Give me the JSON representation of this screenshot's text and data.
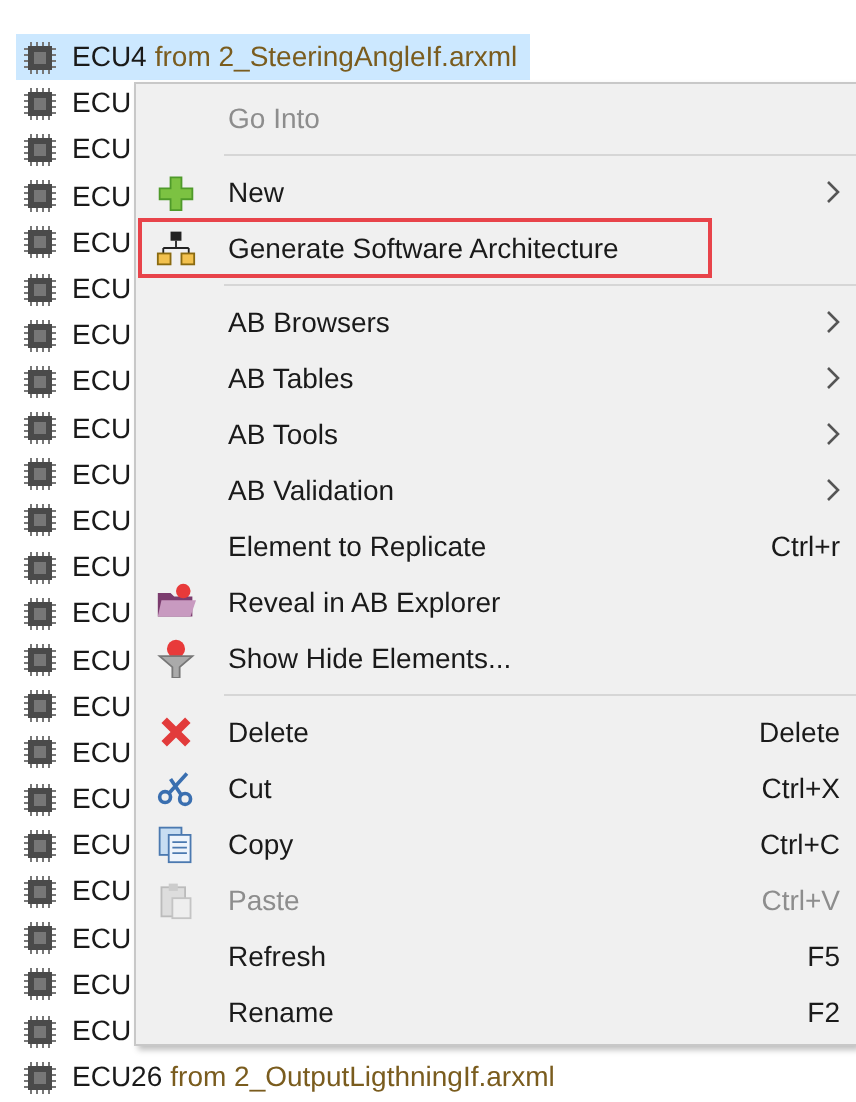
{
  "tree": {
    "rows": [
      {
        "name": "ECU4",
        "source": "from 2_SteeringAngleIf.arxml",
        "selected": true
      },
      {
        "name": "ECU",
        "selected": false
      },
      {
        "name": "ECU",
        "selected": false
      },
      {
        "name": "ECU",
        "selected": false
      },
      {
        "name": "ECU",
        "selected": false
      },
      {
        "name": "ECU",
        "selected": false
      },
      {
        "name": "ECU",
        "selected": false
      },
      {
        "name": "ECU",
        "selected": false
      },
      {
        "name": "ECU",
        "selected": false
      },
      {
        "name": "ECU",
        "selected": false
      },
      {
        "name": "ECU",
        "selected": false
      },
      {
        "name": "ECU",
        "selected": false
      },
      {
        "name": "ECU",
        "selected": false
      },
      {
        "name": "ECU",
        "selected": false
      },
      {
        "name": "ECU",
        "selected": false
      },
      {
        "name": "ECU",
        "selected": false
      },
      {
        "name": "ECU",
        "selected": false
      },
      {
        "name": "ECU",
        "selected": false
      },
      {
        "name": "ECU",
        "selected": false
      },
      {
        "name": "ECU",
        "selected": false
      },
      {
        "name": "ECU",
        "selected": false
      },
      {
        "name": "ECU",
        "selected": false
      },
      {
        "name": "ECU26",
        "source": "from 2_OutputLigthningIf.arxml",
        "selected": false
      }
    ]
  },
  "context_menu": {
    "items": [
      {
        "kind": "command",
        "label": "Go Into",
        "disabled": true
      },
      {
        "kind": "separator"
      },
      {
        "kind": "command",
        "label": "New",
        "submenu": true
      },
      {
        "kind": "command",
        "label": "Generate Software Architecture",
        "outlined": true
      },
      {
        "kind": "separator"
      },
      {
        "kind": "command",
        "label": "AB Browsers",
        "submenu": true
      },
      {
        "kind": "command",
        "label": "AB Tables",
        "submenu": true
      },
      {
        "kind": "command",
        "label": "AB Tools",
        "submenu": true
      },
      {
        "kind": "command",
        "label": "AB Validation",
        "submenu": true
      },
      {
        "kind": "command",
        "label": "Element to Replicate",
        "shortcut": "Ctrl+r"
      },
      {
        "kind": "command",
        "label": "Reveal in AB Explorer"
      },
      {
        "kind": "command",
        "label": "Show Hide Elements..."
      },
      {
        "kind": "separator"
      },
      {
        "kind": "command",
        "label": "Delete",
        "shortcut": "Delete"
      },
      {
        "kind": "command",
        "label": "Cut",
        "shortcut": "Ctrl+X"
      },
      {
        "kind": "command",
        "label": "Copy",
        "shortcut": "Ctrl+C"
      },
      {
        "kind": "command",
        "label": "Paste",
        "shortcut": "Ctrl+V",
        "disabled": true
      },
      {
        "kind": "command",
        "label": "Refresh",
        "shortcut": "F5"
      },
      {
        "kind": "command",
        "label": "Rename",
        "shortcut": "F2"
      }
    ]
  }
}
